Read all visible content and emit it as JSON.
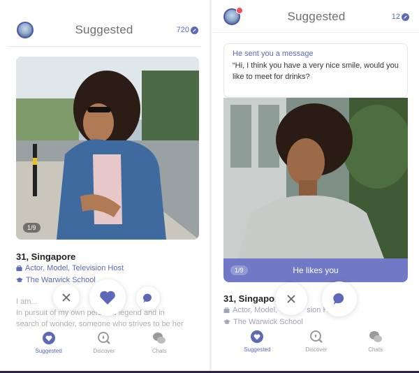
{
  "left": {
    "header": {
      "title": "Suggested",
      "credits": "720"
    },
    "profile": {
      "photo_counter": "1/9",
      "name_age": "31, Singapore",
      "occupation": "Actor, Model, Television Host",
      "school": "The Warwick School",
      "bio_heading": "I am...",
      "bio_line1": "In pursuit of my own personal legend and in",
      "bio_line2": "search of wonder, someone who strives to be her"
    }
  },
  "right": {
    "header": {
      "title": "Suggested",
      "credits": "12"
    },
    "message": {
      "title": "He sent you a message",
      "body": "“Hi, I think you have a very nice smile, would you like to meet for drinks?"
    },
    "profile": {
      "photo_counter": "1/9",
      "likes_label": "He likes you",
      "name_age": "31, Singapor",
      "occupation": "Actor, Model,",
      "occupation_tail": "sion H",
      "school": "The Warwick School"
    }
  },
  "tabbar": {
    "tabs": [
      {
        "label": "Suggested",
        "icon": "heart-badge-icon",
        "active": true
      },
      {
        "label": "Discover",
        "icon": "discover-icon",
        "active": false
      },
      {
        "label": "Chats",
        "icon": "chat-bubbles-icon",
        "active": false
      }
    ]
  },
  "colors": {
    "accent": "#5d68b8",
    "likes_bar": "#7179c6",
    "notification": "#ee4f5a"
  }
}
